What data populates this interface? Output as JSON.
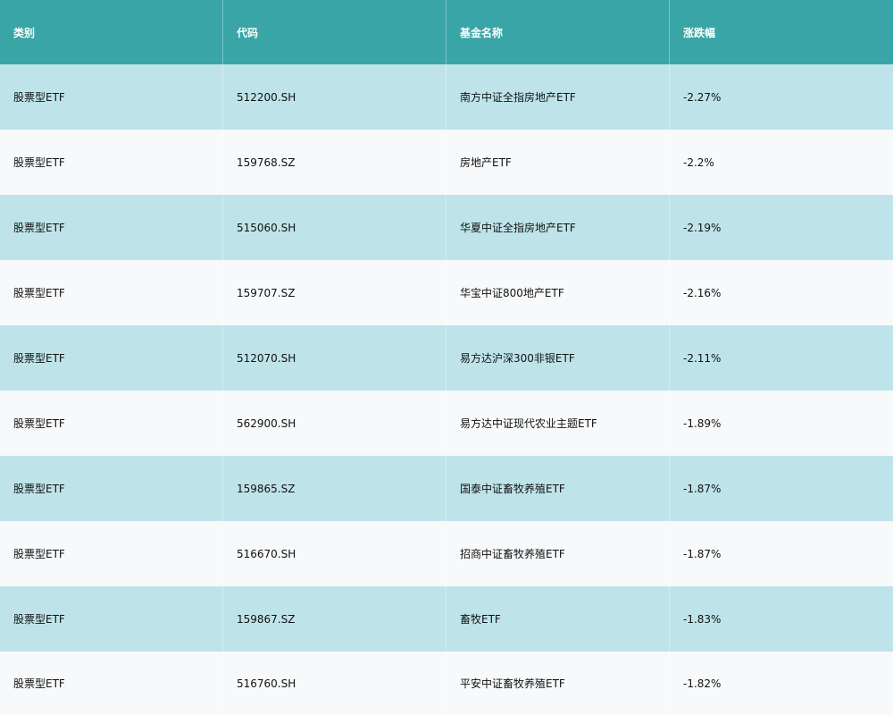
{
  "colors": {
    "header_bg": "#3aa5a6",
    "row_odd_bg": "#bee4ea",
    "row_even_bg": "#f7f9fb"
  },
  "table": {
    "columns": [
      "类别",
      "代码",
      "基金名称",
      "涨跌幅"
    ],
    "rows": [
      [
        "股票型ETF",
        "512200.SH",
        "南方中证全指房地产ETF",
        "-2.27%"
      ],
      [
        "股票型ETF",
        "159768.SZ",
        "房地产ETF",
        "-2.2%"
      ],
      [
        "股票型ETF",
        "515060.SH",
        "华夏中证全指房地产ETF",
        "-2.19%"
      ],
      [
        "股票型ETF",
        "159707.SZ",
        "华宝中证800地产ETF",
        "-2.16%"
      ],
      [
        "股票型ETF",
        "512070.SH",
        "易方达沪深300非银ETF",
        "-2.11%"
      ],
      [
        "股票型ETF",
        "562900.SH",
        "易方达中证现代农业主题ETF",
        "-1.89%"
      ],
      [
        "股票型ETF",
        "159865.SZ",
        "国泰中证畜牧养殖ETF",
        "-1.87%"
      ],
      [
        "股票型ETF",
        "516670.SH",
        "招商中证畜牧养殖ETF",
        "-1.87%"
      ],
      [
        "股票型ETF",
        "159867.SZ",
        "畜牧ETF",
        "-1.83%"
      ],
      [
        "股票型ETF",
        "516760.SH",
        "平安中证畜牧养殖ETF",
        "-1.82%"
      ]
    ]
  }
}
